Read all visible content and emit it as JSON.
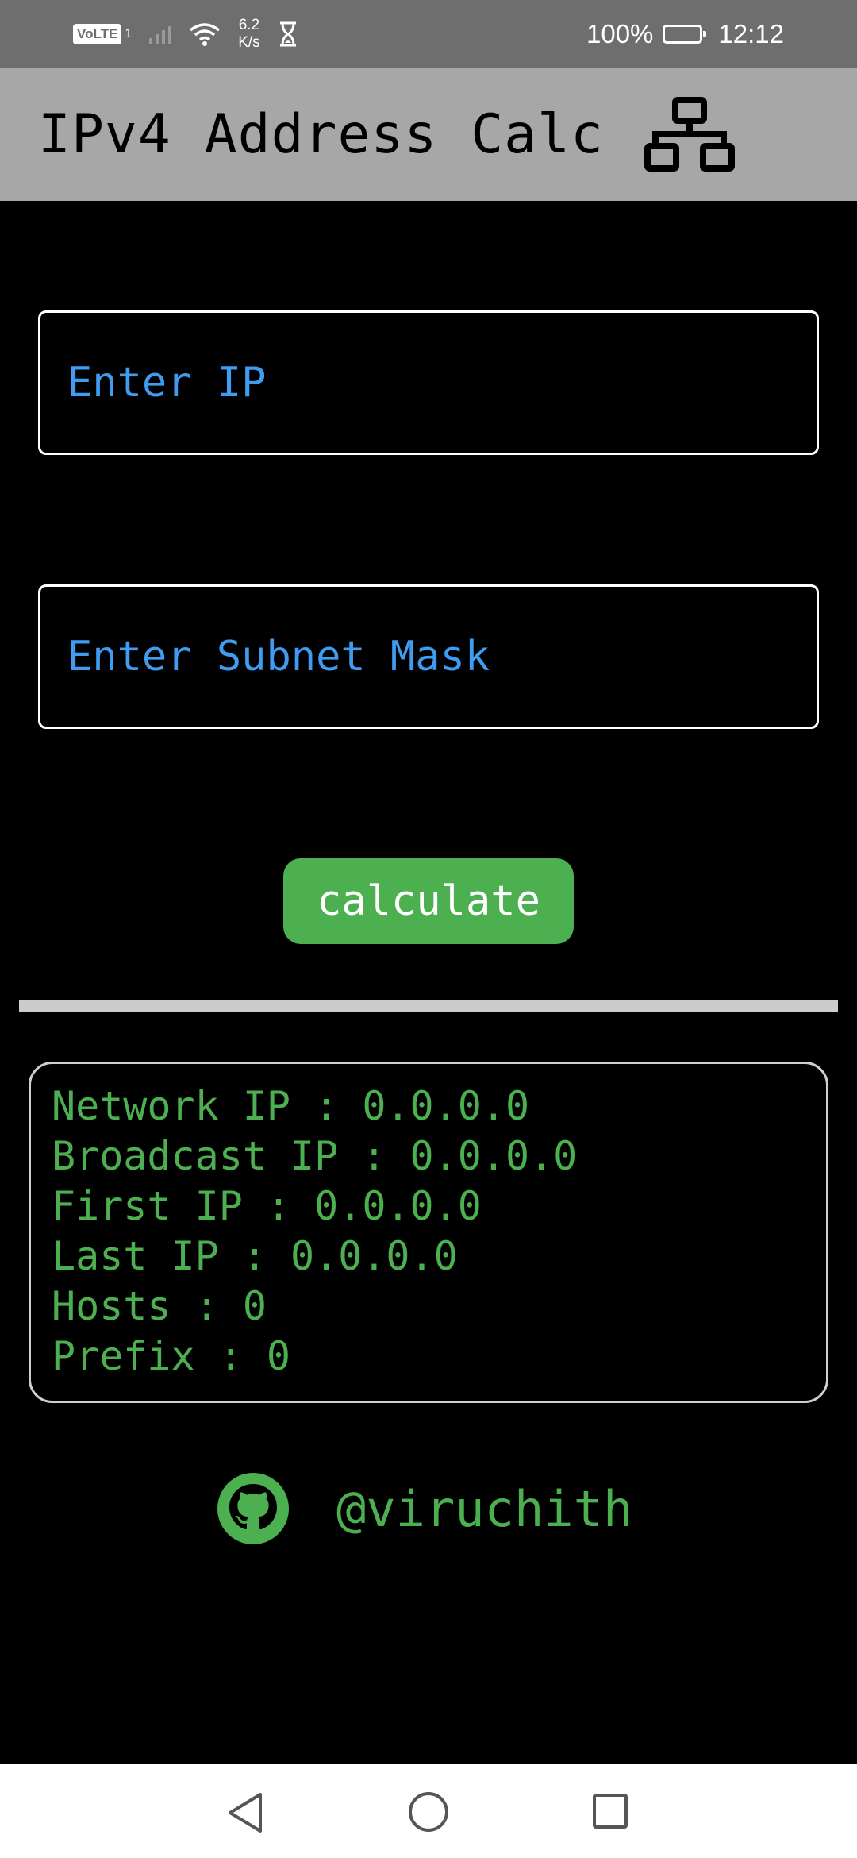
{
  "status_bar": {
    "volte": "VoLTE",
    "sim": "1",
    "speed_value": "6.2",
    "speed_unit": "K/s",
    "battery": "100%",
    "time": "12:12"
  },
  "app_bar": {
    "title": "IPv4 Address Calc",
    "icon": "network-icon"
  },
  "form": {
    "ip_placeholder": "Enter IP",
    "ip_value": "",
    "mask_placeholder": "Enter Subnet Mask",
    "mask_value": "",
    "calculate_label": "calculate"
  },
  "results": {
    "network": "Network IP : 0.0.0.0",
    "broadcast": "Broadcast IP : 0.0.0.0",
    "first": "First IP : 0.0.0.0",
    "last": "Last IP : 0.0.0.0",
    "hosts": "Hosts : 0",
    "prefix": "Prefix : 0"
  },
  "footer": {
    "icon": "github-icon",
    "handle": "@viruchith"
  },
  "colors": {
    "accent_green": "#4caf50",
    "input_text_blue": "#3f9cf0",
    "app_bar_gray": "#a7a7a7",
    "status_bar_gray": "#6e6e6e"
  }
}
